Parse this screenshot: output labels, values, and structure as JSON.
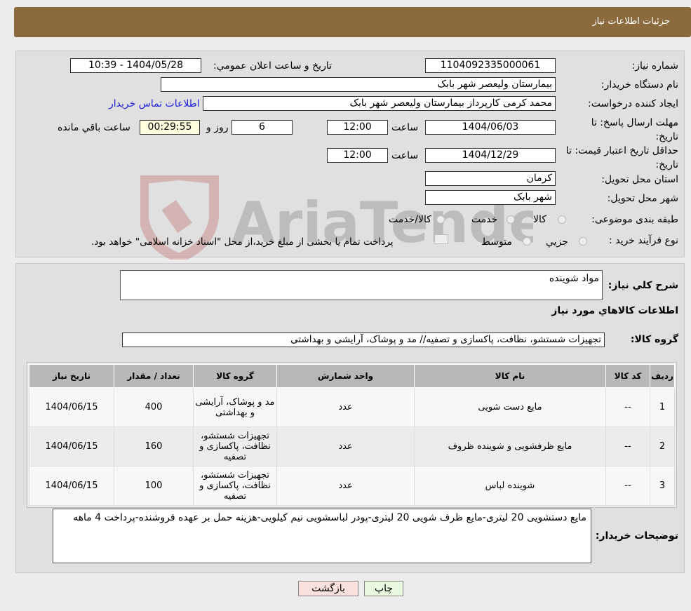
{
  "header": {
    "title": "جزئیات اطلاعات نیاز"
  },
  "form": {
    "need_number_label": "شماره نیاز:",
    "need_number": "1104092335000061",
    "announce_label": "تاریخ و ساعت اعلان عمومي:",
    "announce_value": "1404/05/28 - 10:39",
    "buyer_label": "نام دستگاه خریدار:",
    "buyer_value": "بیمارستان ولیعصر شهر بابک",
    "creator_label": "ایجاد کننده درخواست:",
    "creator_value": "محمد  کرمی  کارپرداز  بیمارستان ولیعصر شهر بابک",
    "contact_link": "اطلاعات تماس خریدار",
    "deadline_label": "مهلت ارسال پاسخ: تا تاریخ:",
    "deadline_date": "1404/06/03",
    "time_label": "ساعت",
    "deadline_time": "12:00",
    "days": "6",
    "days_label": "روز و",
    "remaining": "00:29:55",
    "remaining_label": "ساعت باقي مانده",
    "validity_label": "حداقل تاریخ اعتبار قیمت: تا تاریخ:",
    "validity_date": "1404/12/29",
    "validity_time": "12:00",
    "province_label": "استان محل تحویل:",
    "province_value": "کرمان",
    "city_label": "شهر محل تحویل:",
    "city_value": "شهر بابک",
    "category_label": "طبقه بندی موضوعی:",
    "category_options": [
      "کالا",
      "خدمت",
      "کالا/خدمت"
    ],
    "process_label": "نوع فرآیند خرید :",
    "process_options": [
      "جزيي",
      "متوسط"
    ],
    "process_note": "پرداخت تمام یا بخشی از مبلغ خرید،از محل \"اسناد خزانه اسلامی\" خواهد بود."
  },
  "watermark": "AriaTender.net",
  "details": {
    "summary_label": "شرح کلي نیاز:",
    "summary_value": "مواد شوینده",
    "goods_info_title": "اطلاعات کالاهاي مورد نیاز",
    "group_label": "گروه کالا:",
    "group_value": "تجهیزات شستشو، نظافت، پاکسازی و تصفیه// مد و پوشاک، آرایشی و بهداشتی",
    "table": {
      "headers": [
        "ردیف",
        "کد کالا",
        "نام کالا",
        "واحد شمارش",
        "گروه کالا",
        "تعداد / مقدار",
        "تاریخ نیاز"
      ],
      "rows": [
        [
          "1",
          "--",
          "مایع دست شویی",
          "عدد",
          "مد و پوشاک، آرایشی و بهداشتی",
          "400",
          "1404/06/15"
        ],
        [
          "2",
          "--",
          "مایع ظرفشویی و شوینده ظروف",
          "عدد",
          "تجهیزات شستشو، نظافت، پاکسازی و تصفیه",
          "160",
          "1404/06/15"
        ],
        [
          "3",
          "--",
          "شوینده لباس",
          "عدد",
          "تجهیزات شستشو، نظافت، پاکسازی و تصفیه",
          "100",
          "1404/06/15"
        ]
      ]
    },
    "notes_label": "توضیحات خریدار:",
    "notes_value": "مایع دستشویی 20 لیتری-مایع ظرف شویی 20 لیتری-پودر لباسشویی نیم کیلویی-هزینه حمل بر عهده فروشنده-پرداخت 4 ماهه"
  },
  "buttons": {
    "print": "چاپ",
    "back": "بازگشت"
  }
}
